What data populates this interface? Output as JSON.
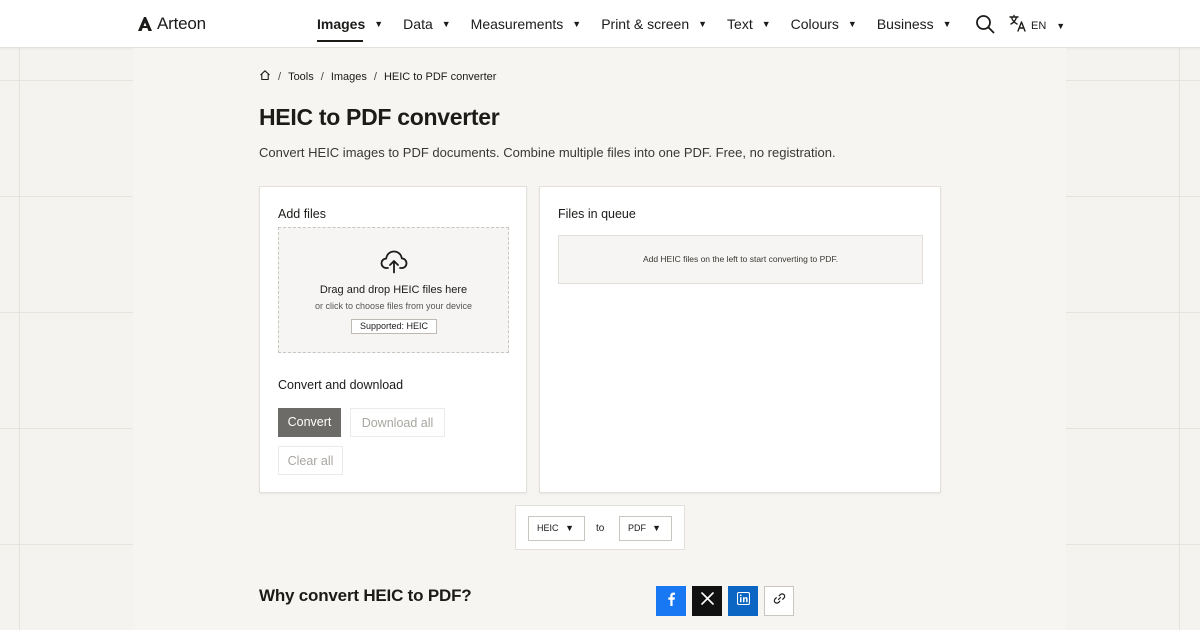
{
  "brand": {
    "name": "Arteon",
    "logo_icon": "arteon-logo-icon"
  },
  "nav": {
    "items": [
      {
        "label": "Images",
        "active": true
      },
      {
        "label": "Data",
        "active": false
      },
      {
        "label": "Measurements",
        "active": false
      },
      {
        "label": "Print & screen",
        "active": false
      },
      {
        "label": "Text",
        "active": false
      },
      {
        "label": "Colours",
        "active": false
      },
      {
        "label": "Business",
        "active": false
      }
    ],
    "caret": "▼",
    "search_icon": "search-icon",
    "language": {
      "icon": "translate-icon",
      "code": "EN",
      "caret": "▼"
    }
  },
  "breadcrumb": {
    "home_icon": "home-icon",
    "separator": "/",
    "items": [
      "Tools",
      "Images",
      "HEIC to PDF converter"
    ]
  },
  "page": {
    "title": "HEIC to PDF converter",
    "description": "Convert HEIC images to PDF documents. Combine multiple files into one PDF. Free, no registration."
  },
  "add_files": {
    "label": "Add files",
    "upload_icon": "cloud-upload-icon",
    "drop_title": "Drag and drop HEIC files here",
    "drop_subtitle": "or click to choose files from your device",
    "supported_badge": "Supported: HEIC"
  },
  "convert_section": {
    "label": "Convert and download",
    "convert_button": "Convert",
    "download_all_button": "Download all",
    "clear_all_button": "Clear all"
  },
  "queue": {
    "label": "Files in queue",
    "empty_message": "Add HEIC files on the left to start converting to PDF."
  },
  "format_selector": {
    "from_value": "HEIC",
    "to_word": "to",
    "to_value": "PDF",
    "caret": "▼"
  },
  "why_section": {
    "title": "Why convert HEIC to PDF?"
  },
  "share": {
    "facebook_icon": "facebook-icon",
    "x_icon": "x-icon",
    "linkedin_icon": "linkedin-icon",
    "link_icon": "link-icon"
  },
  "colors": {
    "page_background": "#f5f3f0",
    "panel_background": "#f7f5f2",
    "primary_button": "#6d6b68",
    "facebook": "#1877f2",
    "x": "#111111",
    "linkedin": "#0a66c2"
  }
}
